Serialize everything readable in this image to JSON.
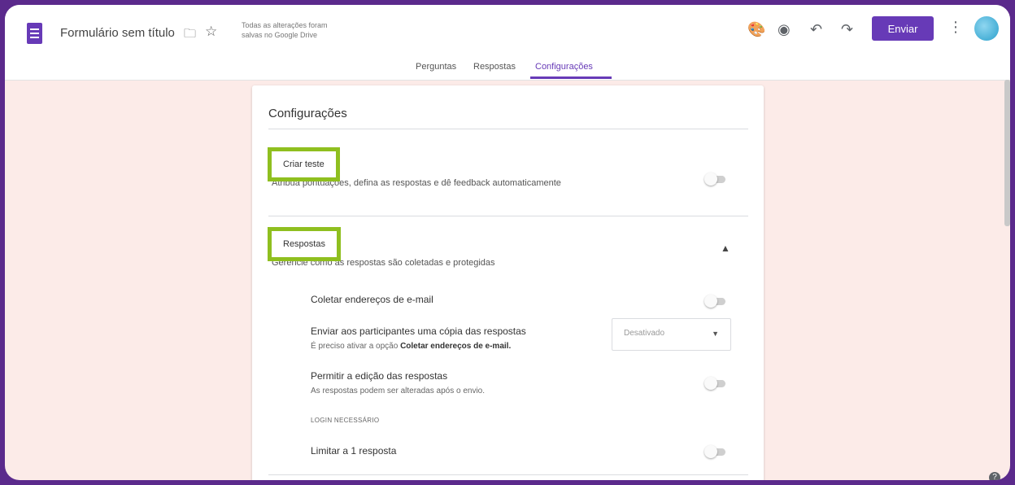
{
  "header": {
    "form_title": "Formulário sem título",
    "save_status_line1": "Todas as alterações foram",
    "save_status_line2": "salvas no Google Drive",
    "send_label": "Enviar"
  },
  "tabs": [
    {
      "label": "Perguntas"
    },
    {
      "label": "Respostas"
    },
    {
      "label": "Configurações",
      "active": true
    }
  ],
  "card": {
    "title": "Configurações",
    "quiz": {
      "title": "Criar teste",
      "description": "Atribua pontuações, defina as respostas e dê feedback automaticamente",
      "enabled": false
    },
    "responses": {
      "title": "Respostas",
      "description": "Gerencie como as respostas são coletadas e protegidas",
      "options": [
        {
          "label": "Coletar endereços de e-mail",
          "enabled": false
        },
        {
          "label": "Enviar aos participantes uma cópia das respostas",
          "sub_prefix": "É preciso ativar a opção",
          "sub_bold": "Coletar endereços de e-mail.",
          "select_value": "Desativado"
        },
        {
          "label": "Permitir a edição das respostas",
          "sub": "As respostas podem ser alteradas após o envio.",
          "enabled": false
        },
        {
          "label": "Limitar a 1 resposta",
          "enabled": false
        }
      ],
      "login_caption": "LOGIN NECESSÁRIO"
    }
  },
  "colors": {
    "accent": "#673ab7",
    "highlight": "#8fbf1f",
    "background": "#fcebe8",
    "outer_frame": "#5b2a8c"
  }
}
